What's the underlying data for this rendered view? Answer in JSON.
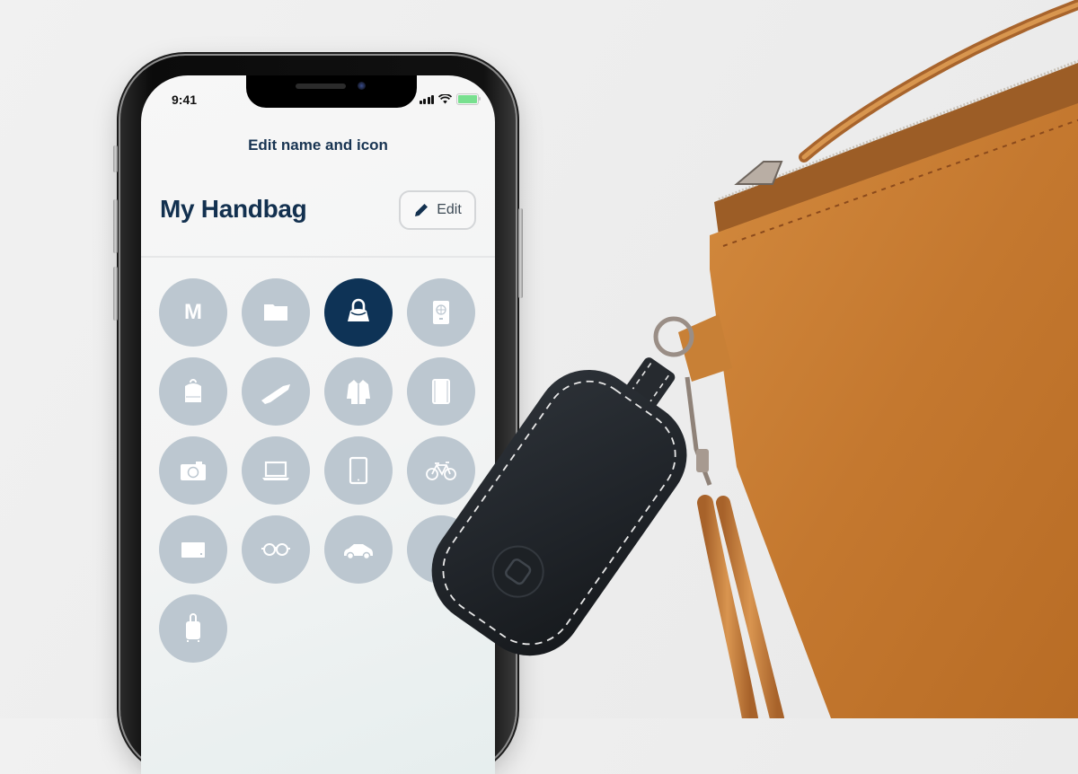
{
  "status_bar": {
    "time": "9:41",
    "signal_icon": "cellular-signal-icon",
    "wifi_icon": "wifi-icon",
    "battery_icon": "battery-icon"
  },
  "screen": {
    "nav_title": "Edit name and icon",
    "item_name": "My Handbag",
    "edit_button": {
      "label": "Edit",
      "icon": "pencil-icon"
    }
  },
  "icon_grid": {
    "selected": "handbag",
    "items": [
      {
        "id": "letter-m",
        "label": "M",
        "icon": "letter-m-icon",
        "selected": false
      },
      {
        "id": "wallet",
        "icon": "wallet-icon",
        "selected": false
      },
      {
        "id": "handbag",
        "icon": "handbag-icon",
        "selected": true
      },
      {
        "id": "passport",
        "icon": "passport-icon",
        "selected": false
      },
      {
        "id": "backpack",
        "icon": "backpack-icon",
        "selected": false
      },
      {
        "id": "guitar",
        "icon": "guitar-icon",
        "selected": false
      },
      {
        "id": "jacket",
        "icon": "jacket-icon",
        "selected": false
      },
      {
        "id": "notebook",
        "icon": "notebook-icon",
        "selected": false
      },
      {
        "id": "camera",
        "icon": "camera-icon",
        "selected": false
      },
      {
        "id": "laptop",
        "icon": "laptop-icon",
        "selected": false
      },
      {
        "id": "tablet",
        "icon": "tablet-icon",
        "selected": false
      },
      {
        "id": "bicycle",
        "icon": "bicycle-icon",
        "selected": false
      },
      {
        "id": "wallet-card",
        "icon": "card-wallet-icon",
        "selected": false
      },
      {
        "id": "glasses",
        "icon": "glasses-icon",
        "selected": false
      },
      {
        "id": "car",
        "icon": "car-icon",
        "selected": false
      },
      {
        "id": "partially-hidden",
        "icon": "hidden-icon",
        "selected": false
      },
      {
        "id": "luggage",
        "icon": "luggage-icon",
        "selected": false
      }
    ]
  },
  "colors": {
    "accent": "#0e3356",
    "icon_bg": "#bcc7d0",
    "title_text": "#12304f",
    "battery": "#78e08f",
    "leather": "#c4782f",
    "tracker": "#23272d"
  },
  "scene": {
    "tracker": "bluetooth-tracker-device",
    "bag": "tan-leather-handbag"
  }
}
